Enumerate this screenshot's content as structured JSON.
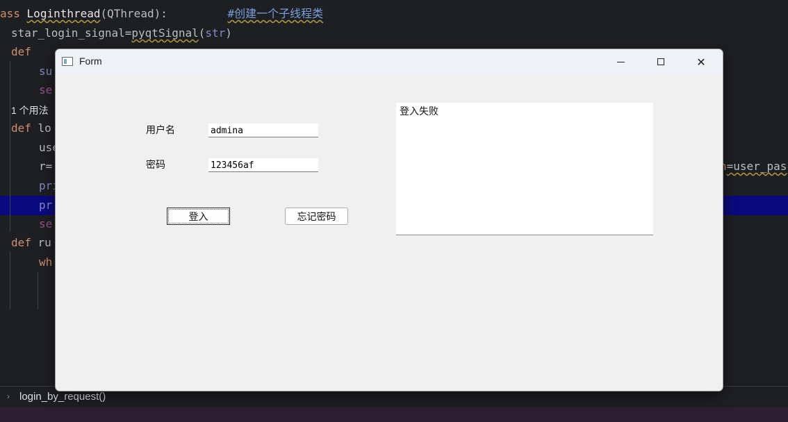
{
  "editor": {
    "line1": {
      "kw": "ass",
      "cls": "Loginthread",
      "paren": "(QThread):",
      "comment": "#创建一个子线程类"
    },
    "line2": {
      "name": "star_login_signal",
      "eq": "=",
      "call": "pyqtSignal",
      "open": "(",
      "arg": "str",
      "close": ")"
    },
    "line3_kw": "def",
    "line4_frag": "su",
    "line5_frag": "se",
    "usages_hint": "1 个用法",
    "line6": {
      "kw": "def",
      "frag": "lo"
    },
    "line7_frag": "use",
    "line8_frag": "r=",
    "line8_right": {
      "n": "n",
      "rest": "=user_pas"
    },
    "line9_frag": "pri",
    "line10_frag": "pr",
    "line11_frag": "se",
    "line12": {
      "kw": "def",
      "frag": "ru"
    },
    "line13_frag": "wh"
  },
  "breadcrumb": {
    "chevron": "›",
    "item": "login_by_request()"
  },
  "window": {
    "title": "Form",
    "app_icon": "qt-window-icon",
    "controls": {
      "minimize": "minimize-icon",
      "maximize": "maximize-icon",
      "close": "close-icon",
      "close_glyph": "✕"
    }
  },
  "form": {
    "username_label": "用户名",
    "username_value": "admina",
    "password_label": "密码",
    "password_value": "123456af",
    "login_button": "登入",
    "forgot_button": "忘记密码",
    "output_text": "登入失败"
  }
}
